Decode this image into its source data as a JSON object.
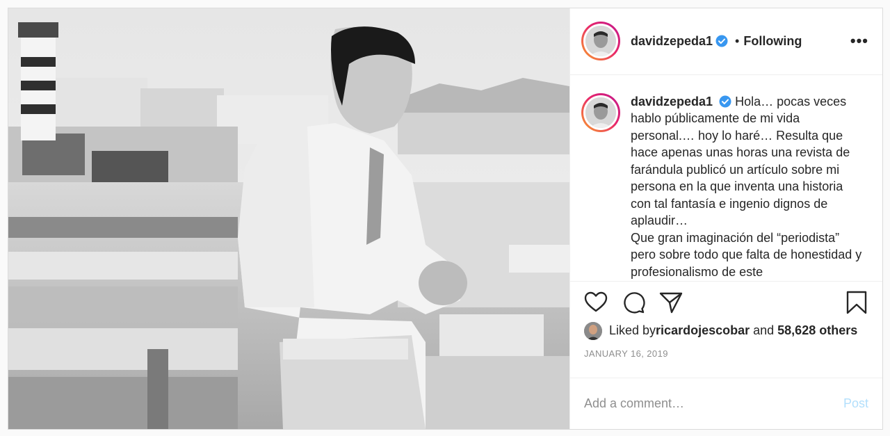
{
  "post": {
    "username": "davidzepeda1",
    "follow_dot": "•",
    "follow_status": "Following",
    "more_label": "•••",
    "caption": "Hola… pocas veces hablo públicamente de mi vida personal.… hoy lo haré… Resulta que hace apenas unas horas una revista de farándula publicó un artículo sobre mi persona en la que inventa una historia con tal fantasía e ingenio dignos de aplaudir…\nQue gran imaginación del “periodista” pero sobre todo que falta de honestidad y profesionalismo de este",
    "liked_by_prefix": "Liked by ",
    "liked_by_user": "ricardojescobar",
    "liked_by_mid": " and ",
    "liked_by_others": "58,628 others",
    "date": "JANUARY 16, 2019",
    "comment_placeholder": "Add a comment…",
    "post_label": "Post"
  },
  "icons": {
    "like": "heart-icon",
    "comment": "comment-icon",
    "share": "paper-plane-icon",
    "save": "bookmark-icon",
    "verified": "verified-badge-icon"
  },
  "colors": {
    "verified_blue": "#3897f0",
    "post_disabled": "#b2dffc",
    "muted": "#8e8e8e"
  }
}
